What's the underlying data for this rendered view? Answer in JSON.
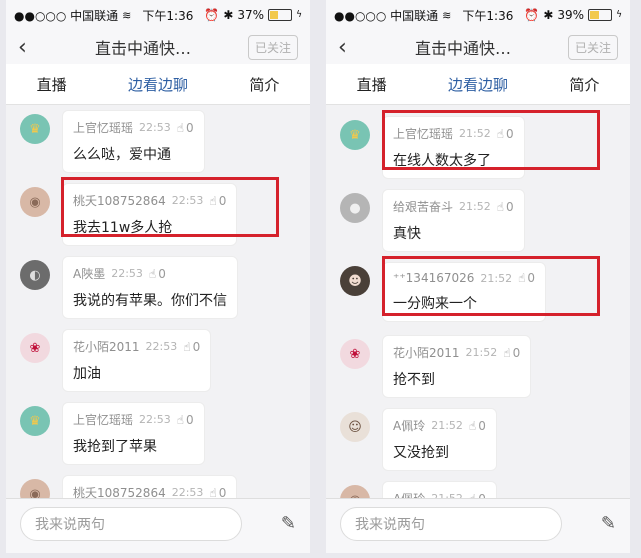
{
  "left": {
    "status": {
      "carrier": "●●○○○ 中国联通",
      "time": "下午1:36",
      "battery": "37%",
      "battery_level": 0.37
    },
    "nav": {
      "title": "直击中通快…",
      "follow": "已关注"
    },
    "tabs": [
      "直播",
      "边看边聊",
      "简介"
    ],
    "active_tab": 1,
    "messages": [
      {
        "avatar": "crown",
        "name": "上官忆瑶瑶",
        "time": "22:53",
        "likes": "0",
        "text": "么么哒，爱中通",
        "highlight": false
      },
      {
        "avatar": "skin",
        "name": "桃夭108752864",
        "time": "22:53",
        "likes": "0",
        "text": "我去11w多人抢",
        "highlight": true
      },
      {
        "avatar": "bw",
        "name": "A陜墨",
        "time": "22:53",
        "likes": "0",
        "text": "我说的有苹果。你们不信",
        "highlight": false
      },
      {
        "avatar": "rose",
        "name": "花小陌2011",
        "time": "22:53",
        "likes": "0",
        "text": "加油",
        "highlight": false
      },
      {
        "avatar": "crown",
        "name": "上官忆瑶瑶",
        "time": "22:53",
        "likes": "0",
        "text": "我抢到了苹果",
        "highlight": false
      },
      {
        "avatar": "skin",
        "name": "桃夭108752864",
        "time": "22:53",
        "likes": "0",
        "text": "",
        "highlight": false
      }
    ],
    "input_placeholder": "我来说两句"
  },
  "right": {
    "status": {
      "carrier": "●●○○○ 中国联通",
      "time": "下午1:36",
      "battery": "39%",
      "battery_level": 0.39
    },
    "nav": {
      "title": "直击中通快…",
      "follow": "已关注"
    },
    "tabs": [
      "直播",
      "边看边聊",
      "简介"
    ],
    "active_tab": 1,
    "messages": [
      {
        "avatar": "crown",
        "name": "上官忆瑶瑶",
        "time": "21:52",
        "likes": "0",
        "text": "在线人数太多了",
        "highlight": true
      },
      {
        "avatar": "gray",
        "name": "给艰苦奋斗",
        "time": "21:52",
        "likes": "0",
        "text": "真快",
        "highlight": false
      },
      {
        "avatar": "girl",
        "name": "⁺⁺134167026",
        "time": "21:52",
        "likes": "0",
        "text": "一分购来一个",
        "highlight": true
      },
      {
        "avatar": "rose",
        "name": "花小陌2011",
        "time": "21:52",
        "likes": "0",
        "text": "抢不到",
        "highlight": false
      },
      {
        "avatar": "face",
        "name": "A佩玲",
        "time": "21:52",
        "likes": "0",
        "text": "又没抢到",
        "highlight": false
      },
      {
        "avatar": "skin",
        "name": "A佩玲",
        "time": "21:52",
        "likes": "0",
        "text": "",
        "highlight": false
      }
    ],
    "input_placeholder": "我来说两句"
  },
  "icons": {
    "back": "chevron-left-icon",
    "thumb": "thumb-up-icon",
    "compose": "compose-icon",
    "wifi": "wifi-icon",
    "alarm": "alarm-icon",
    "bluetooth": "bluetooth-icon",
    "battery": "battery-icon"
  },
  "colors": {
    "tab_active": "#2e5fa3",
    "highlight": "#d5212b"
  }
}
